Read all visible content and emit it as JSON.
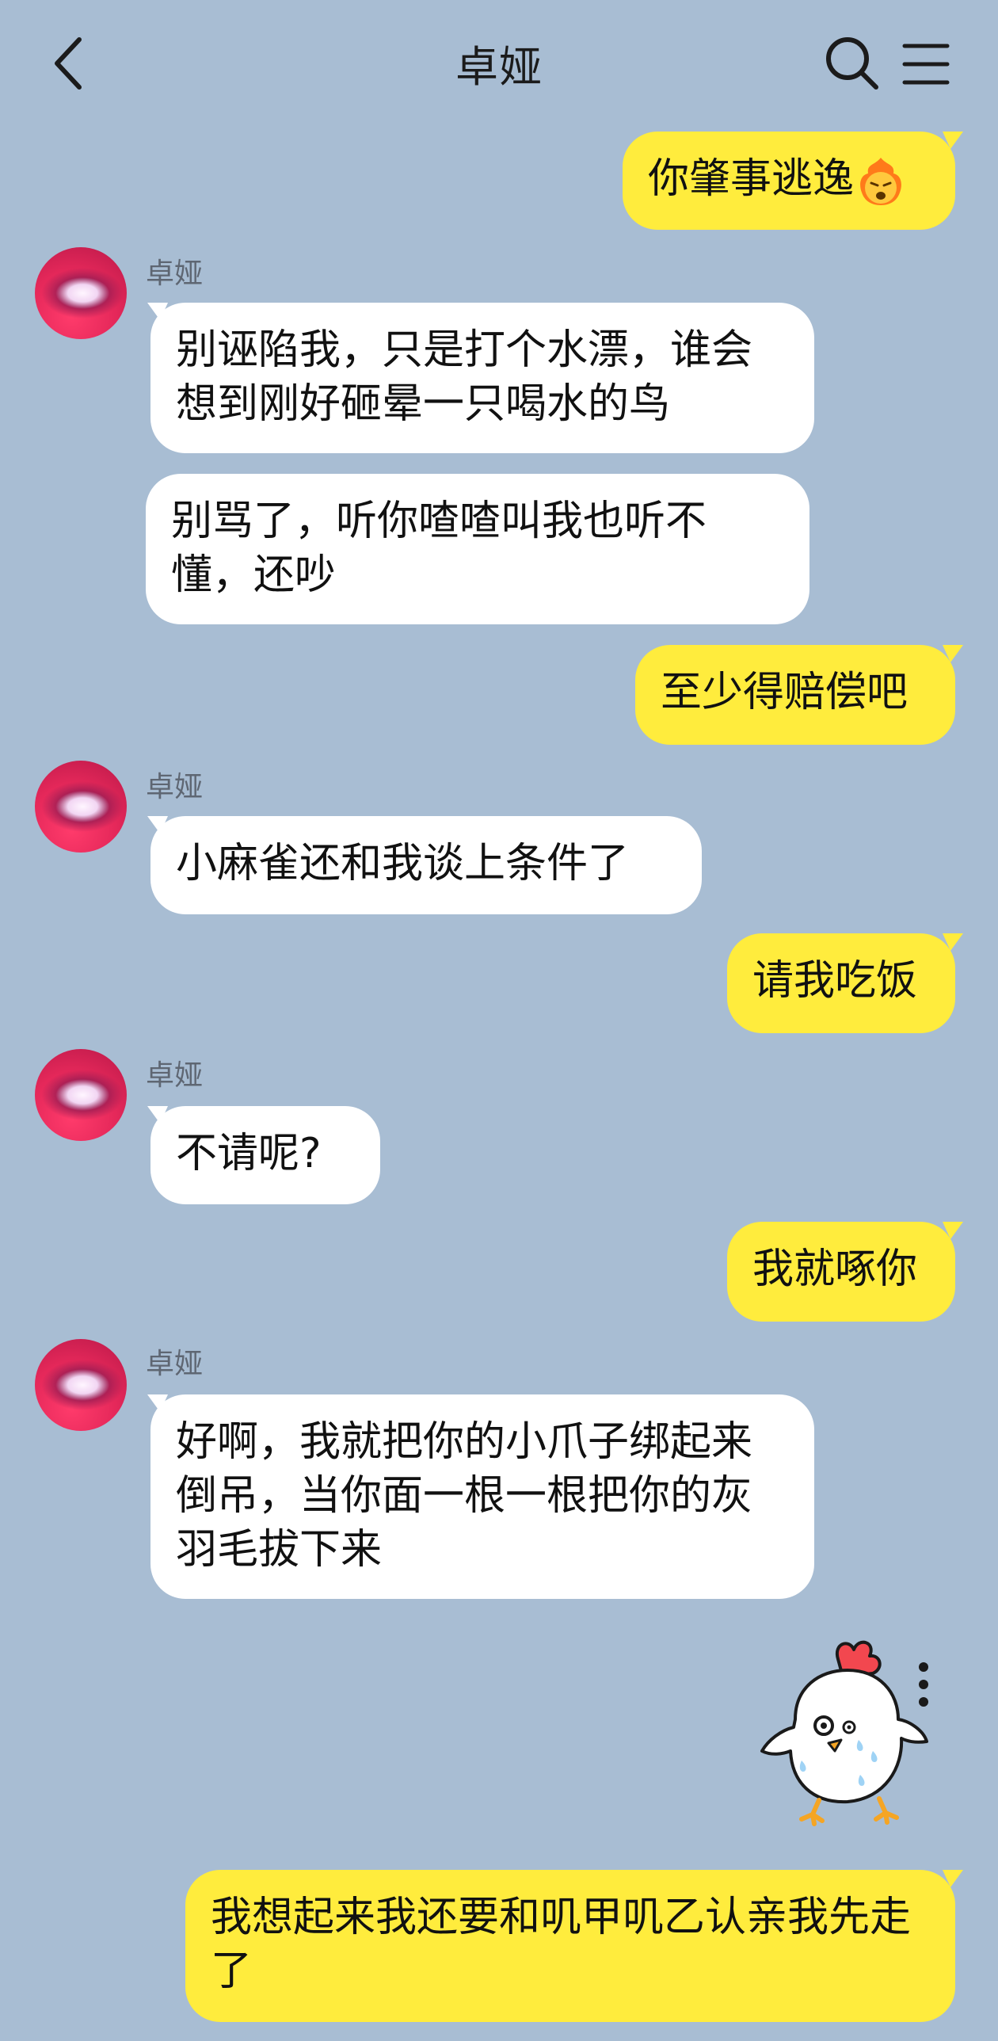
{
  "header": {
    "title": "卓娅",
    "back_icon": "chevron-left-icon",
    "search_icon": "search-icon",
    "menu_icon": "menu-icon"
  },
  "colors": {
    "background": "#a8bdd3",
    "own_bubble": "#ffec3d",
    "other_bubble": "#ffffff"
  },
  "messages": [
    {
      "from": "me",
      "text": "你肇事逃逸",
      "emoji": "angry-face-emoji"
    },
    {
      "from": "卓娅",
      "sender_label": "卓娅",
      "texts": [
        "别诬陷我，只是打个水漂，谁会想到刚好砸晕一只喝水的鸟",
        "别骂了，听你喳喳叫我也听不懂，还吵"
      ]
    },
    {
      "from": "me",
      "text": "至少得赔偿吧"
    },
    {
      "from": "卓娅",
      "sender_label": "卓娅",
      "texts": [
        "小麻雀还和我谈上条件了"
      ]
    },
    {
      "from": "me",
      "text": "请我吃饭"
    },
    {
      "from": "卓娅",
      "sender_label": "卓娅",
      "texts": [
        "不请呢?"
      ]
    },
    {
      "from": "me",
      "text": "我就啄你"
    },
    {
      "from": "卓娅",
      "sender_label": "卓娅",
      "texts": [
        "好啊，我就把你的小爪子绑起来倒吊，当你面一根一根把你的灰羽毛拔下来"
      ]
    },
    {
      "from": "me",
      "sticker": "nervous-chick-sticker"
    },
    {
      "from": "me",
      "text": "我想起来我还要和叽甲叽乙认亲我先走了"
    }
  ]
}
